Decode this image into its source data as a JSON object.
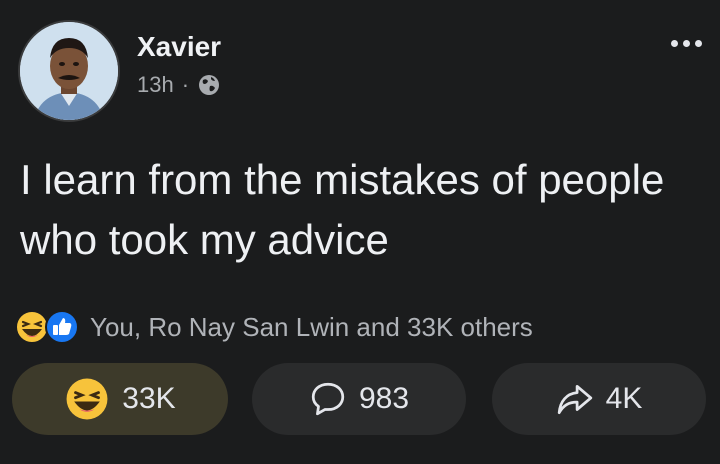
{
  "post": {
    "author": "Xavier",
    "time": "13h",
    "separator": "·",
    "audience_icon": "globe-icon",
    "more_icon": "more-dots-icon",
    "text": "I learn from the mistakes of people who took my advice"
  },
  "reactions": {
    "icons": [
      "laughing-emoji-icon",
      "like-thumb-icon"
    ],
    "summary": "You, Ro Nay San Lwin and 33K others"
  },
  "actions": {
    "react": {
      "icon": "laughing-emoji-icon",
      "count": "33K"
    },
    "comment": {
      "icon": "comment-bubble-icon",
      "count": "983"
    },
    "share": {
      "icon": "share-arrow-icon",
      "count": "4K"
    }
  },
  "colors": {
    "background": "#1b1c1d",
    "text": "#eef0f3",
    "secondary_text": "#a8abaf",
    "button": "#2a2b2c",
    "active_button": "#3d3a2a",
    "haha_yellow": "#f7c33b",
    "like_blue": "#1877f2"
  }
}
